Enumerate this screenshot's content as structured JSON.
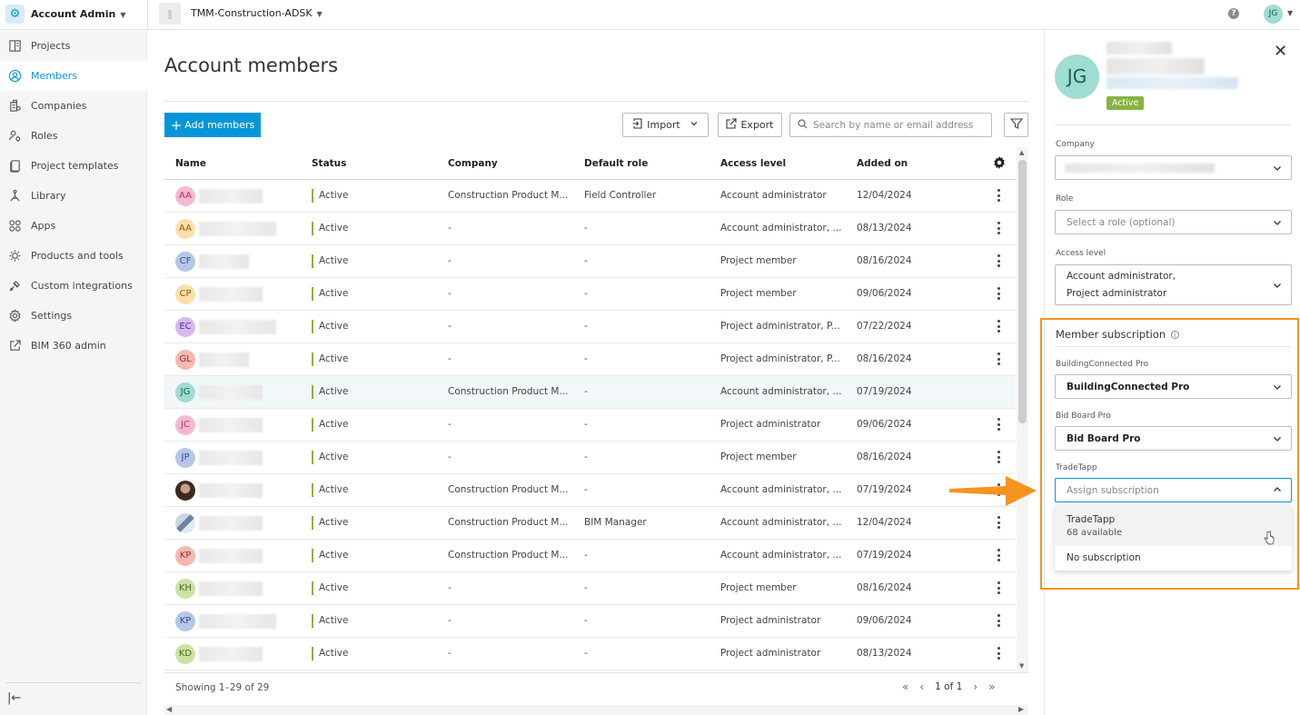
{
  "topbar": {
    "app_name": "Account Admin",
    "project_name": "TMM-Construction-ADSK",
    "user_initials": "JG"
  },
  "sidebar": {
    "items": [
      {
        "label": "Projects",
        "icon": "projects-icon"
      },
      {
        "label": "Members",
        "icon": "members-icon",
        "active": true
      },
      {
        "label": "Companies",
        "icon": "companies-icon"
      },
      {
        "label": "Roles",
        "icon": "roles-icon"
      },
      {
        "label": "Project templates",
        "icon": "templates-icon"
      },
      {
        "label": "Library",
        "icon": "library-icon"
      },
      {
        "label": "Apps",
        "icon": "apps-icon"
      },
      {
        "label": "Products and tools",
        "icon": "products-icon"
      },
      {
        "label": "Custom integrations",
        "icon": "integrations-icon"
      },
      {
        "label": "Settings",
        "icon": "settings-icon"
      },
      {
        "label": "BIM 360 admin",
        "icon": "external-link-icon"
      }
    ]
  },
  "main": {
    "title": "Account members",
    "add_members": "Add members",
    "import": "Import",
    "export": "Export",
    "search_placeholder": "Search by name or email address",
    "columns": [
      "Name",
      "Status",
      "Company",
      "Default role",
      "Access level",
      "Added on"
    ],
    "rows": [
      {
        "initials": "AA",
        "status": "Active",
        "company": "Construction Product M...",
        "role": "Field Controller",
        "access": "Account administrator",
        "added": "12/04/2024"
      },
      {
        "initials": "AA",
        "status": "Active",
        "company": "-",
        "role": "-",
        "access": "Account administrator, ...",
        "added": "08/13/2024"
      },
      {
        "initials": "CF",
        "status": "Active",
        "company": "-",
        "role": "-",
        "access": "Project member",
        "added": "08/16/2024"
      },
      {
        "initials": "CP",
        "status": "Active",
        "company": "-",
        "role": "-",
        "access": "Project member",
        "added": "09/06/2024"
      },
      {
        "initials": "EC",
        "status": "Active",
        "company": "-",
        "role": "-",
        "access": "Project administrator, P...",
        "added": "07/22/2024"
      },
      {
        "initials": "GL",
        "status": "Active",
        "company": "-",
        "role": "-",
        "access": "Project administrator, P...",
        "added": "08/16/2024"
      },
      {
        "initials": "JG",
        "status": "Active",
        "company": "Construction Product M...",
        "role": "-",
        "access": "Account administrator, ...",
        "added": "07/19/2024"
      },
      {
        "initials": "JC",
        "status": "Active",
        "company": "-",
        "role": "-",
        "access": "Project administrator",
        "added": "09/06/2024"
      },
      {
        "initials": "JP",
        "status": "Active",
        "company": "-",
        "role": "-",
        "access": "Project member",
        "added": "08/16/2024"
      },
      {
        "initials": "",
        "status": "Active",
        "company": "Construction Product M...",
        "role": "-",
        "access": "Account administrator, ...",
        "added": "07/19/2024"
      },
      {
        "initials": "",
        "status": "Active",
        "company": "Construction Product M...",
        "role": "BIM Manager",
        "access": "Account administrator, ...",
        "added": "12/04/2024"
      },
      {
        "initials": "KP",
        "status": "Active",
        "company": "Construction Product M...",
        "role": "-",
        "access": "Account administrator, ...",
        "added": "07/19/2024"
      },
      {
        "initials": "KH",
        "status": "Active",
        "company": "-",
        "role": "-",
        "access": "Project member",
        "added": "08/16/2024"
      },
      {
        "initials": "KP",
        "status": "Active",
        "company": "-",
        "role": "-",
        "access": "Project administrator",
        "added": "09/06/2024"
      },
      {
        "initials": "KD",
        "status": "Active",
        "company": "-",
        "role": "-",
        "access": "Project administrator",
        "added": "08/13/2024"
      }
    ],
    "showing": "Showing 1–29 of 29",
    "page": "1 of 1"
  },
  "panel": {
    "initials": "JG",
    "status": "Active",
    "company_label": "Company",
    "role_label": "Role",
    "role_placeholder": "Select a role (optional)",
    "access_label": "Access level",
    "access_line1": "Account administrator,",
    "access_line2": "Project administrator",
    "subscription_title": "Member subscription",
    "bc_label": "BuildingConnected Pro",
    "bc_value": "BuildingConnected Pro",
    "bb_label": "Bid Board Pro",
    "bb_value": "Bid Board Pro",
    "tt_label": "TradeTapp",
    "tt_placeholder": "Assign subscription",
    "options": [
      {
        "label": "TradeTapp",
        "sub": "68 available"
      },
      {
        "label": "No subscription"
      }
    ]
  },
  "colors": {
    "accent": "#0696d7",
    "active": "#87b340",
    "callout": "#f5941f"
  }
}
